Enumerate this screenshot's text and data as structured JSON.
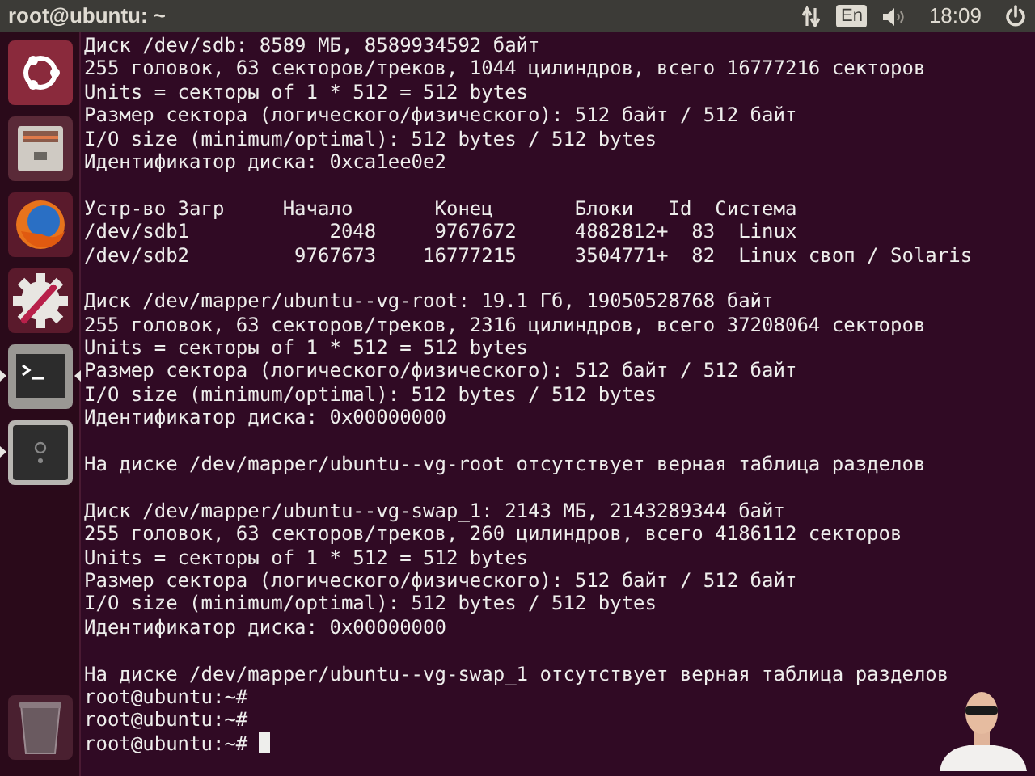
{
  "top_panel": {
    "window_title": "root@ubuntu: ~",
    "keyboard_layout": "En",
    "clock": "18:09"
  },
  "launcher": {
    "items": [
      {
        "kind": "dash",
        "running": false,
        "focused": false
      },
      {
        "kind": "files",
        "running": false,
        "focused": false
      },
      {
        "kind": "browser",
        "running": false,
        "focused": false
      },
      {
        "kind": "settings",
        "running": false,
        "focused": false
      },
      {
        "kind": "terminal",
        "running": true,
        "focused": true
      },
      {
        "kind": "app",
        "running": true,
        "focused": false
      },
      {
        "kind": "trash",
        "running": false,
        "focused": false
      }
    ]
  },
  "terminal": {
    "blocks": [
      [
        {
          "kind": "output",
          "text": "Диск /dev/sdb: 8589 МБ, 8589934592 байт"
        },
        {
          "kind": "output",
          "text": "255 головок, 63 секторов/треков, 1044 цилиндров, всего 16777216 секторов"
        },
        {
          "kind": "output",
          "text": "Units = секторы of 1 * 512 = 512 bytes"
        },
        {
          "kind": "output",
          "text": "Размер сектора (логического/физического): 512 байт / 512 байт"
        },
        {
          "kind": "output",
          "text": "I/O size (minimum/optimal): 512 bytes / 512 bytes"
        },
        {
          "kind": "output",
          "text": "Идентификатор диска: 0xca1ee0e2"
        }
      ],
      [
        {
          "kind": "output",
          "text": "Устр-во Загр     Начало       Конец       Блоки   Id  Система"
        },
        {
          "kind": "output",
          "text": "/dev/sdb1            2048     9767672     4882812+  83  Linux"
        },
        {
          "kind": "output",
          "text": "/dev/sdb2         9767673    16777215     3504771+  82  Linux своп / Solaris"
        }
      ],
      [
        {
          "kind": "output",
          "text": "Диск /dev/mapper/ubuntu--vg-root: 19.1 Гб, 19050528768 байт"
        },
        {
          "kind": "output",
          "text": "255 головок, 63 секторов/треков, 2316 цилиндров, всего 37208064 секторов"
        },
        {
          "kind": "output",
          "text": "Units = секторы of 1 * 512 = 512 bytes"
        },
        {
          "kind": "output",
          "text": "Размер сектора (логического/физического): 512 байт / 512 байт"
        },
        {
          "kind": "output",
          "text": "I/O size (minimum/optimal): 512 bytes / 512 bytes"
        },
        {
          "kind": "output",
          "text": "Идентификатор диска: 0x00000000"
        }
      ],
      [
        {
          "kind": "output",
          "text": "На диске /dev/mapper/ubuntu--vg-root отсутствует верная таблица разделов"
        }
      ],
      [
        {
          "kind": "output",
          "text": "Диск /dev/mapper/ubuntu--vg-swap_1: 2143 МБ, 2143289344 байт"
        },
        {
          "kind": "output",
          "text": "255 головок, 63 секторов/треков, 260 цилиндров, всего 4186112 секторов"
        },
        {
          "kind": "output",
          "text": "Units = секторы of 1 * 512 = 512 bytes"
        },
        {
          "kind": "output",
          "text": "Размер сектора (логического/физического): 512 байт / 512 байт"
        },
        {
          "kind": "output",
          "text": "I/O size (minimum/optimal): 512 bytes / 512 bytes"
        },
        {
          "kind": "output",
          "text": "Идентификатор диска: 0x00000000"
        }
      ],
      [
        {
          "kind": "output",
          "text": "На диске /dev/mapper/ubuntu--vg-swap_1 отсутствует верная таблица разделов"
        },
        {
          "kind": "prompt",
          "text": "root@ubuntu:~#",
          "cursor": false
        },
        {
          "kind": "prompt",
          "text": "root@ubuntu:~#",
          "cursor": false
        },
        {
          "kind": "prompt",
          "text": "root@ubuntu:~#",
          "cursor": true
        }
      ]
    ]
  }
}
